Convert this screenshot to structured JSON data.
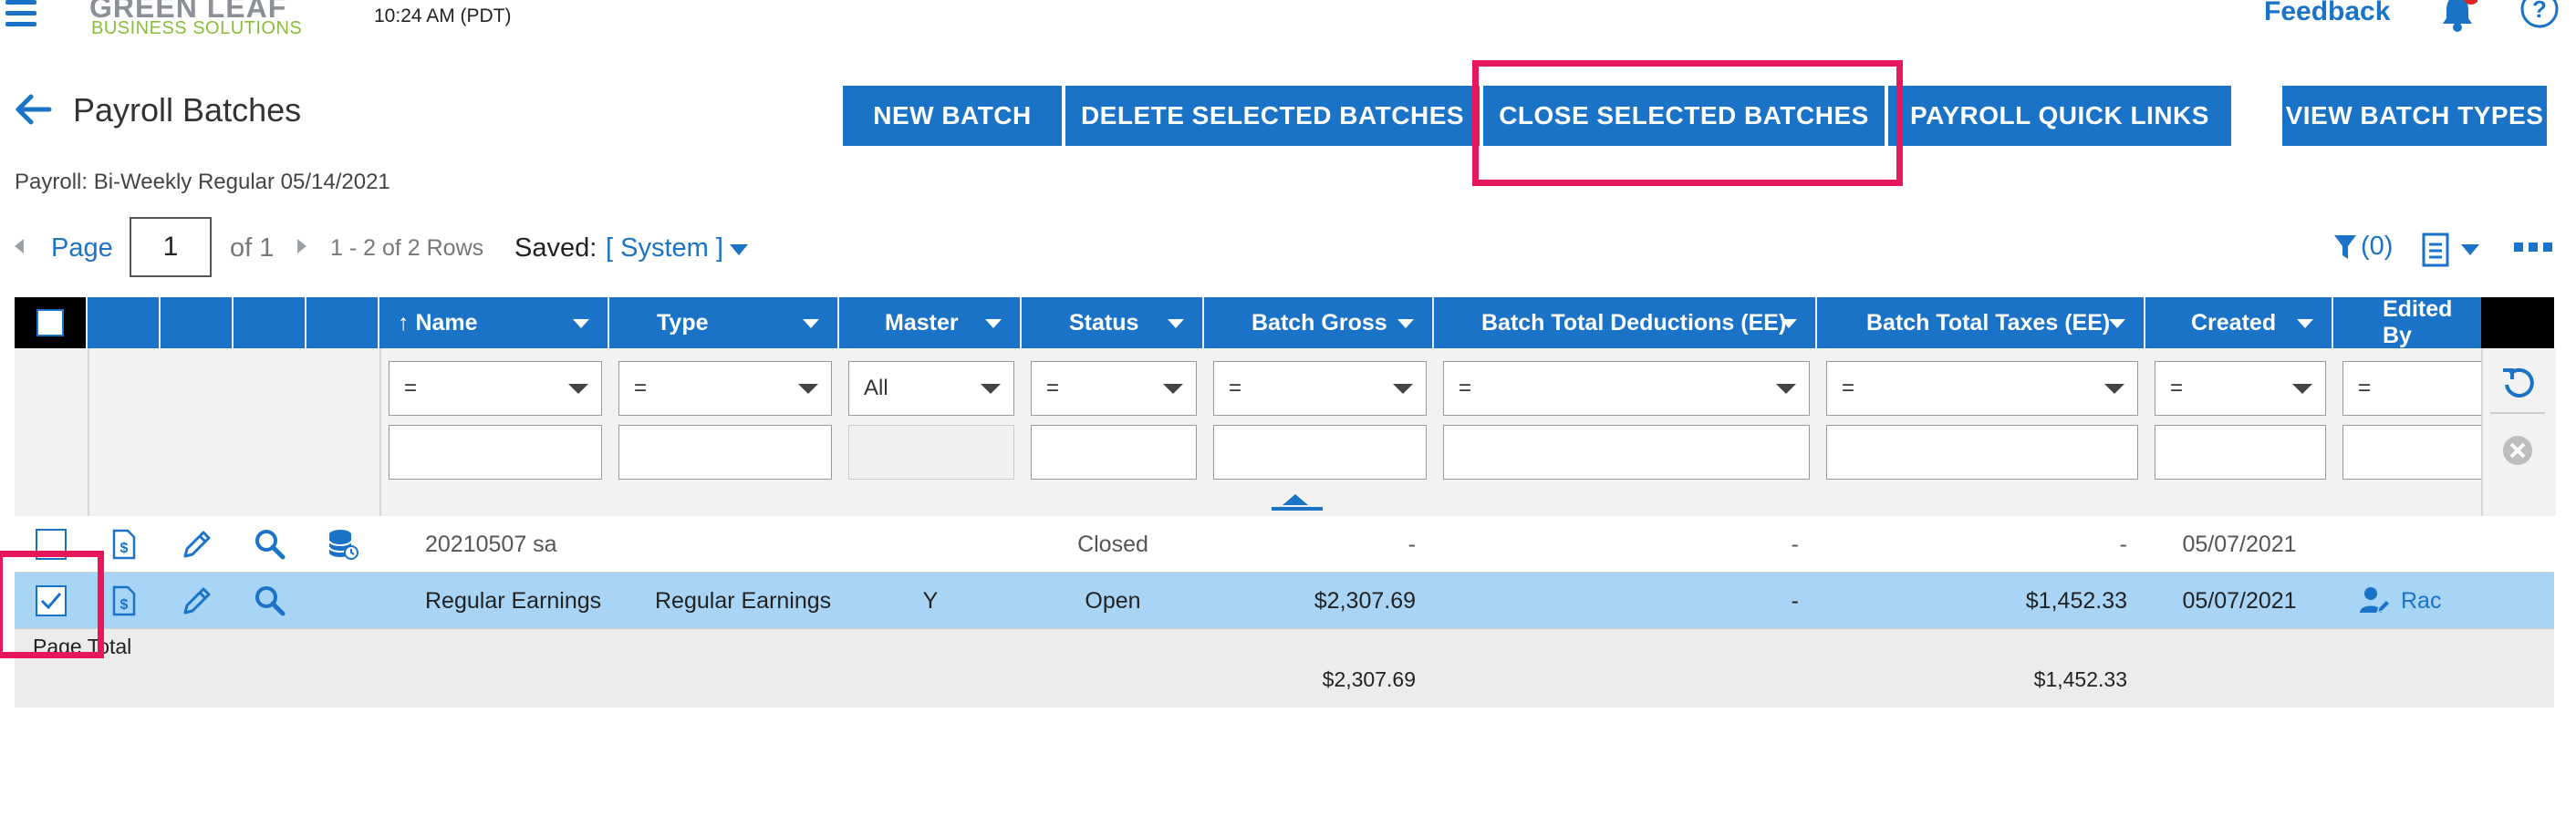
{
  "header": {
    "logo_line1": "GREEN LEAF",
    "logo_line2": "BUSINESS SOLUTIONS",
    "time": "10:24 AM (PDT)",
    "feedback_label": "Feedback"
  },
  "page": {
    "title": "Payroll Batches",
    "subtitle": "Payroll: Bi-Weekly Regular 05/14/2021"
  },
  "toolbar": {
    "buttons": [
      "NEW BATCH",
      "DELETE SELECTED BATCHES",
      "CLOSE SELECTED BATCHES",
      "PAYROLL QUICK LINKS",
      "VIEW BATCH TYPES"
    ]
  },
  "pager": {
    "page_label": "Page",
    "page_value": "1",
    "of_label": "of 1",
    "rows_info": "1 - 2 of 2 Rows",
    "saved_label": "Saved:",
    "saved_value": "[ System ]",
    "filter_count": "(0)"
  },
  "grid": {
    "columns": [
      "↑  Name",
      "Type",
      "Master",
      "Status",
      "Batch Gross",
      "Batch Total Deductions (EE)",
      "Batch Total Taxes (EE)",
      "Created",
      "Edited By"
    ],
    "filters": [
      "=",
      "=",
      "All",
      "=",
      "=",
      "=",
      "=",
      "=",
      "="
    ],
    "rows": [
      {
        "name": "20210507 sa",
        "type": "",
        "master": "",
        "status": "Closed",
        "gross": "-",
        "deductions": "-",
        "taxes": "-",
        "created": "05/07/2021",
        "edited_by": "",
        "selected": false
      },
      {
        "name": "Regular Earnings",
        "type": "Regular Earnings",
        "master": "Y",
        "status": "Open",
        "gross": "$2,307.69",
        "deductions": "-",
        "taxes": "$1,452.33",
        "created": "05/07/2021",
        "edited_by": "Rac",
        "selected": true
      }
    ],
    "totals": {
      "label": "Page Total",
      "gross": "$2,307.69",
      "taxes": "$1,452.33"
    }
  },
  "colors": {
    "primary": "#1a73c6",
    "highlight": "#e8165a",
    "selected_row": "#a8d4f5"
  },
  "icons": [
    "menu-icon",
    "bell-icon",
    "help-icon",
    "back-arrow-icon",
    "document-dollar-icon",
    "pencil-icon",
    "magnifier-icon",
    "database-icon",
    "filter-icon",
    "export-icon",
    "more-icon",
    "refresh-icon",
    "clear-icon",
    "user-edit-icon"
  ]
}
